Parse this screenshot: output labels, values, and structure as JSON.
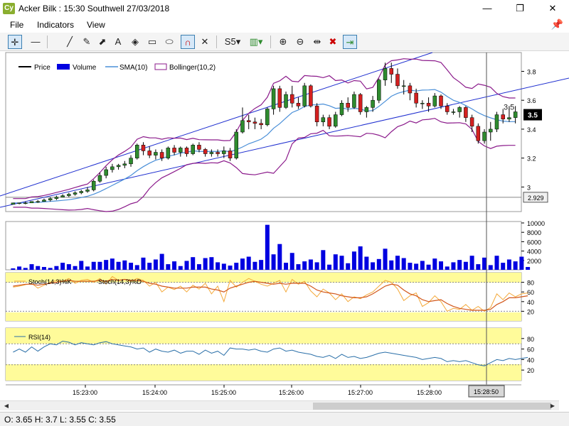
{
  "window": {
    "app_icon": "Cy",
    "title": "Acker Bilk : 15:30 Southwell 27/03/2018",
    "minimize": "—",
    "maximize": "❐",
    "close": "✕"
  },
  "menu": [
    "File",
    "Indicators",
    "View"
  ],
  "toolbar": {
    "icons": [
      "crosshair-icon",
      "horizontal-line-icon",
      "trend-line-icon",
      "pencil-icon",
      "arrow-icon",
      "text-icon",
      "shapes-icon",
      "rectangle-icon",
      "ellipse-icon",
      "magnet-icon",
      "delete-icon",
      "period-icon",
      "candle-type-icon",
      "zoom-in-icon",
      "zoom-out-icon",
      "fit-icon",
      "remove-indicator-icon",
      "export-icon"
    ],
    "period_label": "S5"
  },
  "legend": {
    "price": "Price",
    "volume": "Volume",
    "sma": "SMA(10)",
    "bollinger": "Bollinger(10,2)"
  },
  "stoch_legend": {
    "k": "Stoch(14,3)%K",
    "d": "Stoch(14,3)%D"
  },
  "rsi_legend": "RSI(14)",
  "price_axis": [
    "3.8",
    "3.6",
    "3.4",
    "3.2",
    "3"
  ],
  "price_current": "3.5",
  "price_cursor_label": "2.929",
  "price_annotation": "3.5",
  "volume_axis": [
    "10000",
    "8000",
    "6000",
    "4000",
    "2000"
  ],
  "stoch_axis": [
    "80",
    "60",
    "40",
    "20"
  ],
  "rsi_axis": [
    "80",
    "60",
    "40",
    "20"
  ],
  "time_axis": [
    "15:23:00",
    "15:24:00",
    "15:25:00",
    "15:26:00",
    "15:27:00",
    "15:28:00"
  ],
  "cursor_time": "15:28:50",
  "status": "O:  3.65   H:  3.7   L:  3.55   C:  3.55",
  "colors": {
    "up": "#2e8b2e",
    "down": "#d42020",
    "volume": "#0000e0",
    "sma": "#4a8fd8",
    "bollinger": "#8b1a8b",
    "trend": "#1f2fd0",
    "stoch_k": "#f4a93a",
    "stoch_d": "#d2571a",
    "rsi": "#2a6fa8",
    "band": "#fffb9a"
  },
  "chart_data": {
    "type": "candlestick",
    "candles": [
      [
        2.88,
        2.89,
        2.88,
        2.89
      ],
      [
        2.89,
        2.89,
        2.88,
        2.89
      ],
      [
        2.89,
        2.9,
        2.88,
        2.89
      ],
      [
        2.89,
        2.9,
        2.89,
        2.9
      ],
      [
        2.9,
        2.91,
        2.89,
        2.9
      ],
      [
        2.9,
        2.92,
        2.9,
        2.91
      ],
      [
        2.91,
        2.93,
        2.9,
        2.92
      ],
      [
        2.92,
        2.94,
        2.91,
        2.93
      ],
      [
        2.93,
        2.95,
        2.93,
        2.94
      ],
      [
        2.94,
        2.96,
        2.93,
        2.95
      ],
      [
        2.95,
        2.97,
        2.94,
        2.96
      ],
      [
        2.96,
        2.98,
        2.95,
        2.97
      ],
      [
        2.97,
        3.0,
        2.96,
        2.98
      ],
      [
        2.98,
        3.05,
        2.97,
        3.04
      ],
      [
        3.04,
        3.1,
        3.03,
        3.08
      ],
      [
        3.08,
        3.14,
        3.06,
        3.12
      ],
      [
        3.12,
        3.16,
        3.1,
        3.14
      ],
      [
        3.14,
        3.16,
        3.12,
        3.15
      ],
      [
        3.15,
        3.18,
        3.13,
        3.16
      ],
      [
        3.16,
        3.22,
        3.14,
        3.2
      ],
      [
        3.2,
        3.3,
        3.19,
        3.29
      ],
      [
        3.29,
        3.31,
        3.22,
        3.25
      ],
      [
        3.25,
        3.28,
        3.2,
        3.22
      ],
      [
        3.22,
        3.26,
        3.19,
        3.24
      ],
      [
        3.24,
        3.26,
        3.18,
        3.2
      ],
      [
        3.2,
        3.28,
        3.19,
        3.27
      ],
      [
        3.27,
        3.29,
        3.22,
        3.24
      ],
      [
        3.24,
        3.28,
        3.21,
        3.27
      ],
      [
        3.27,
        3.28,
        3.21,
        3.23
      ],
      [
        3.23,
        3.3,
        3.22,
        3.29
      ],
      [
        3.29,
        3.31,
        3.24,
        3.26
      ],
      [
        3.26,
        3.27,
        3.21,
        3.23
      ],
      [
        3.23,
        3.26,
        3.21,
        3.24
      ],
      [
        3.24,
        3.26,
        3.21,
        3.23
      ],
      [
        3.23,
        3.28,
        3.2,
        3.25
      ],
      [
        3.25,
        3.27,
        3.18,
        3.2
      ],
      [
        3.2,
        3.4,
        3.19,
        3.38
      ],
      [
        3.38,
        3.55,
        3.37,
        3.46
      ],
      [
        3.46,
        3.5,
        3.4,
        3.45
      ],
      [
        3.45,
        3.48,
        3.4,
        3.44
      ],
      [
        3.44,
        3.47,
        3.4,
        3.43
      ],
      [
        3.43,
        3.55,
        3.42,
        3.54
      ],
      [
        3.54,
        3.7,
        3.5,
        3.68
      ],
      [
        3.68,
        3.7,
        3.52,
        3.55
      ],
      [
        3.55,
        3.66,
        3.54,
        3.64
      ],
      [
        3.64,
        3.7,
        3.55,
        3.58
      ],
      [
        3.58,
        3.62,
        3.54,
        3.56
      ],
      [
        3.56,
        3.72,
        3.55,
        3.7
      ],
      [
        3.7,
        3.71,
        3.55,
        3.56
      ],
      [
        3.56,
        3.58,
        3.42,
        3.45
      ],
      [
        3.45,
        3.5,
        3.42,
        3.48
      ],
      [
        3.48,
        3.5,
        3.4,
        3.42
      ],
      [
        3.42,
        3.52,
        3.41,
        3.5
      ],
      [
        3.5,
        3.6,
        3.49,
        3.58
      ],
      [
        3.58,
        3.62,
        3.52,
        3.55
      ],
      [
        3.55,
        3.66,
        3.54,
        3.64
      ],
      [
        3.64,
        3.65,
        3.5,
        3.52
      ],
      [
        3.52,
        3.56,
        3.48,
        3.55
      ],
      [
        3.55,
        3.63,
        3.52,
        3.6
      ],
      [
        3.6,
        3.75,
        3.58,
        3.74
      ],
      [
        3.74,
        3.86,
        3.7,
        3.82
      ],
      [
        3.82,
        3.86,
        3.72,
        3.78
      ],
      [
        3.78,
        3.82,
        3.68,
        3.7
      ],
      [
        3.7,
        3.74,
        3.64,
        3.7
      ],
      [
        3.7,
        3.72,
        3.6,
        3.65
      ],
      [
        3.65,
        3.68,
        3.55,
        3.58
      ],
      [
        3.58,
        3.6,
        3.54,
        3.58
      ],
      [
        3.58,
        3.62,
        3.52,
        3.56
      ],
      [
        3.56,
        3.65,
        3.55,
        3.63
      ],
      [
        3.63,
        3.64,
        3.54,
        3.56
      ],
      [
        3.56,
        3.58,
        3.5,
        3.52
      ],
      [
        3.52,
        3.54,
        3.5,
        3.52
      ],
      [
        3.52,
        3.56,
        3.48,
        3.55
      ],
      [
        3.55,
        3.56,
        3.45,
        3.48
      ],
      [
        3.48,
        3.5,
        3.38,
        3.42
      ],
      [
        3.42,
        3.44,
        3.3,
        3.32
      ],
      [
        3.32,
        3.4,
        3.3,
        3.38
      ],
      [
        3.38,
        3.45,
        3.32,
        3.4
      ],
      [
        3.4,
        3.52,
        3.38,
        3.5
      ],
      [
        3.5,
        3.54,
        3.44,
        3.47
      ],
      [
        3.47,
        3.56,
        3.45,
        3.48
      ],
      [
        3.48,
        3.56,
        3.44,
        3.52
      ]
    ],
    "volume": [
      300,
      700,
      400,
      1200,
      800,
      600,
      400,
      800,
      1500,
      1200,
      800,
      1900,
      700,
      1700,
      1700,
      2100,
      2400,
      1700,
      2000,
      1500,
      1000,
      2600,
      1500,
      2200,
      3400,
      1200,
      1800,
      800,
      1900,
      2700,
      1200,
      2500,
      2700,
      1600,
      1300,
      900,
      1500,
      2400,
      2800,
      1700,
      2100,
      9600,
      3300,
      5500,
      1500,
      3600,
      1200,
      1800,
      2200,
      1600,
      4200,
      1100,
      3300,
      3000,
      1400,
      3900,
      5000,
      2800,
      1600,
      2300,
      4500,
      2000,
      3000,
      2500,
      1500,
      1300,
      1900,
      1100,
      2400,
      1800,
      700,
      1600,
      2100,
      1700,
      3000,
      1200,
      2600,
      1000,
      3000,
      1500,
      2200,
      1800,
      2800,
      600
    ],
    "stoch_k": [
      70,
      72,
      75,
      78,
      68,
      74,
      80,
      84,
      82,
      88,
      78,
      84,
      86,
      80,
      88,
      76,
      92,
      84,
      86,
      82,
      88,
      84,
      72,
      80,
      60,
      70,
      65,
      72,
      60,
      74,
      66,
      78,
      56,
      72,
      40,
      84,
      70,
      80,
      88,
      82,
      76,
      72,
      78,
      84,
      60,
      86,
      76,
      82,
      62,
      50,
      66,
      58,
      44,
      56,
      40,
      50,
      46,
      54,
      60,
      72,
      84,
      80,
      66,
      42,
      52,
      58,
      30,
      38,
      52,
      40,
      20,
      26,
      24,
      34,
      22,
      30,
      20,
      28,
      56,
      44,
      58,
      50,
      56,
      58
    ],
    "stoch_d": [
      72,
      74,
      76,
      76,
      74,
      76,
      78,
      80,
      82,
      84,
      82,
      82,
      82,
      82,
      84,
      82,
      86,
      84,
      86,
      84,
      84,
      82,
      78,
      76,
      72,
      70,
      68,
      68,
      68,
      70,
      70,
      70,
      66,
      64,
      60,
      68,
      72,
      76,
      80,
      82,
      80,
      78,
      76,
      78,
      76,
      78,
      78,
      78,
      72,
      64,
      60,
      58,
      56,
      52,
      50,
      48,
      48,
      50,
      56,
      64,
      72,
      76,
      74,
      64,
      56,
      52,
      44,
      40,
      42,
      44,
      36,
      30,
      26,
      24,
      22,
      22,
      22,
      24,
      34,
      40,
      48,
      48,
      50,
      52
    ],
    "rsi": [
      54,
      60,
      54,
      64,
      56,
      64,
      70,
      68,
      75,
      73,
      68,
      72,
      70,
      68,
      72,
      74,
      70,
      68,
      66,
      64,
      60,
      62,
      54,
      60,
      56,
      54,
      58,
      52,
      56,
      56,
      50,
      58,
      52,
      56,
      48,
      62,
      60,
      60,
      58,
      60,
      56,
      54,
      60,
      62,
      56,
      58,
      54,
      52,
      50,
      46,
      44,
      48,
      42,
      50,
      44,
      46,
      42,
      44,
      48,
      52,
      54,
      52,
      50,
      48,
      46,
      44,
      40,
      42,
      44,
      42,
      36,
      38,
      36,
      38,
      34,
      30,
      28,
      34,
      40,
      38,
      42,
      40,
      42,
      44
    ],
    "y_price_range": [
      2.83,
      3.93
    ]
  }
}
